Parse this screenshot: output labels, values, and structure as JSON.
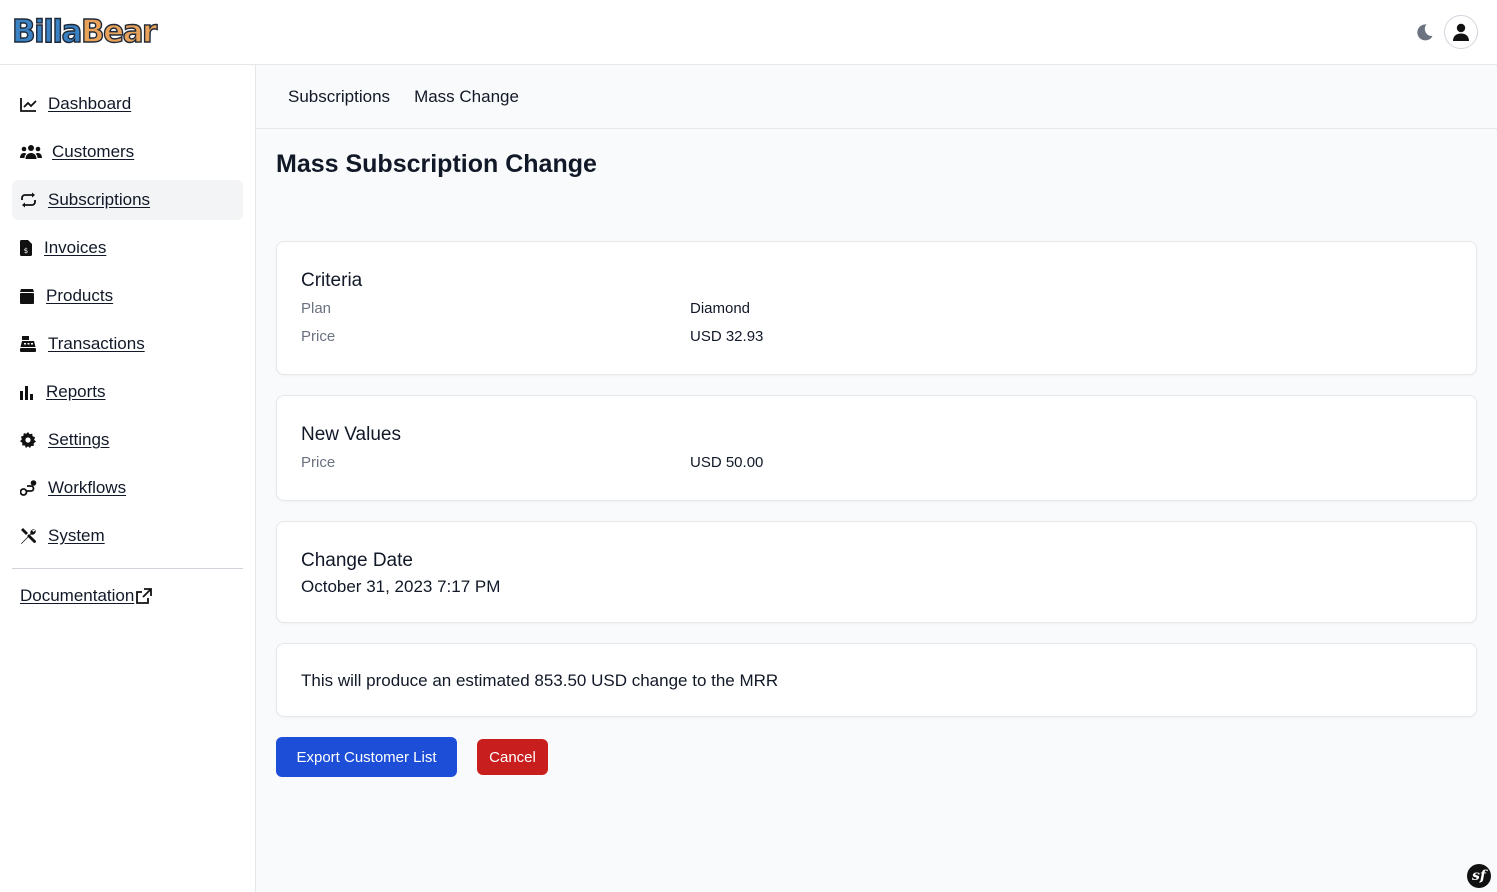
{
  "app": {
    "logo_part1": "Billa",
    "logo_part2": "Bear"
  },
  "header": {
    "theme_icon": "moon-icon",
    "avatar_icon": "user-icon"
  },
  "sidebar": {
    "items": [
      {
        "label": "Dashboard",
        "icon": "chart-line-icon",
        "active": false
      },
      {
        "label": "Customers",
        "icon": "users-icon",
        "active": false
      },
      {
        "label": "Subscriptions",
        "icon": "repeat-icon",
        "active": true
      },
      {
        "label": "Invoices",
        "icon": "invoice-icon",
        "active": false
      },
      {
        "label": "Products",
        "icon": "box-icon",
        "active": false
      },
      {
        "label": "Transactions",
        "icon": "cash-register-icon",
        "active": false
      },
      {
        "label": "Reports",
        "icon": "bar-chart-icon",
        "active": false
      },
      {
        "label": "Settings",
        "icon": "gear-icon",
        "active": false
      },
      {
        "label": "Workflows",
        "icon": "workflow-icon",
        "active": false
      },
      {
        "label": "System",
        "icon": "tools-icon",
        "active": false
      }
    ],
    "documentation_label": "Documentation"
  },
  "breadcrumb": [
    "Subscriptions",
    "Mass Change"
  ],
  "page_title": "Mass Subscription Change",
  "criteria": {
    "title": "Criteria",
    "rows": [
      {
        "label": "Plan",
        "value": "Diamond"
      },
      {
        "label": "Price",
        "value": "USD 32.93"
      }
    ]
  },
  "new_values": {
    "title": "New Values",
    "rows": [
      {
        "label": "Price",
        "value": "USD 50.00"
      }
    ]
  },
  "change_date": {
    "title": "Change Date",
    "value": "October 31, 2023 7:17 PM"
  },
  "estimate_text": "This will produce an estimated 853.50 USD change to the MRR",
  "buttons": {
    "export_label": "Export Customer List",
    "cancel_label": "Cancel"
  },
  "footer": {
    "badge_text": "sf"
  },
  "colors": {
    "primary": "#1d4ed8",
    "danger": "#c81e1e"
  }
}
